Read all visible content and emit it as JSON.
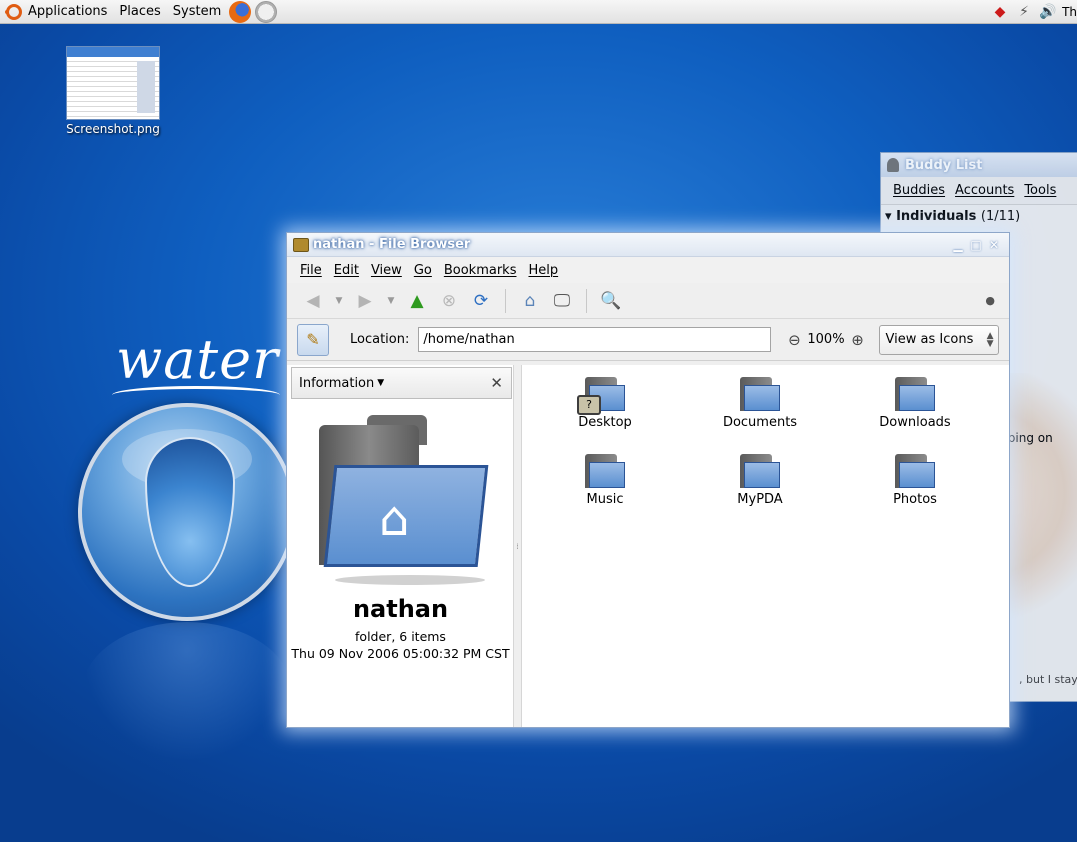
{
  "panel": {
    "menus": [
      "Applications",
      "Places",
      "System"
    ],
    "clock_partial": "Th"
  },
  "desktop": {
    "icons": [
      {
        "label": "Screenshot.png"
      }
    ],
    "wallpaper_text": "water"
  },
  "buddy_list": {
    "title": "Buddy List",
    "menus": [
      "Buddies",
      "Accounts",
      "Tools"
    ],
    "group": "Individuals",
    "group_count": "(1/11)",
    "status_fragment": "eeping on",
    "message_fragment": ", but I staye"
  },
  "file_browser": {
    "title": "nathan - File Browser",
    "menus": [
      "File",
      "Edit",
      "View",
      "Go",
      "Bookmarks",
      "Help"
    ],
    "location_label": "Location:",
    "location_value": "/home/nathan",
    "zoom_level": "100%",
    "view_mode": "View as Icons",
    "side_pane": {
      "header": "Information",
      "name": "nathan",
      "info": "folder, 6 items",
      "date": "Thu 09 Nov 2006 05:00:32 PM CST"
    },
    "items": [
      {
        "label": "Desktop"
      },
      {
        "label": "Documents"
      },
      {
        "label": "Downloads"
      },
      {
        "label": "Music"
      },
      {
        "label": "MyPDA"
      },
      {
        "label": "Photos"
      }
    ]
  },
  "colors": {
    "desktop_blue": "#0f5fc0",
    "folder_blue": "#5a8fd0",
    "window_border": "#8da6c9"
  }
}
